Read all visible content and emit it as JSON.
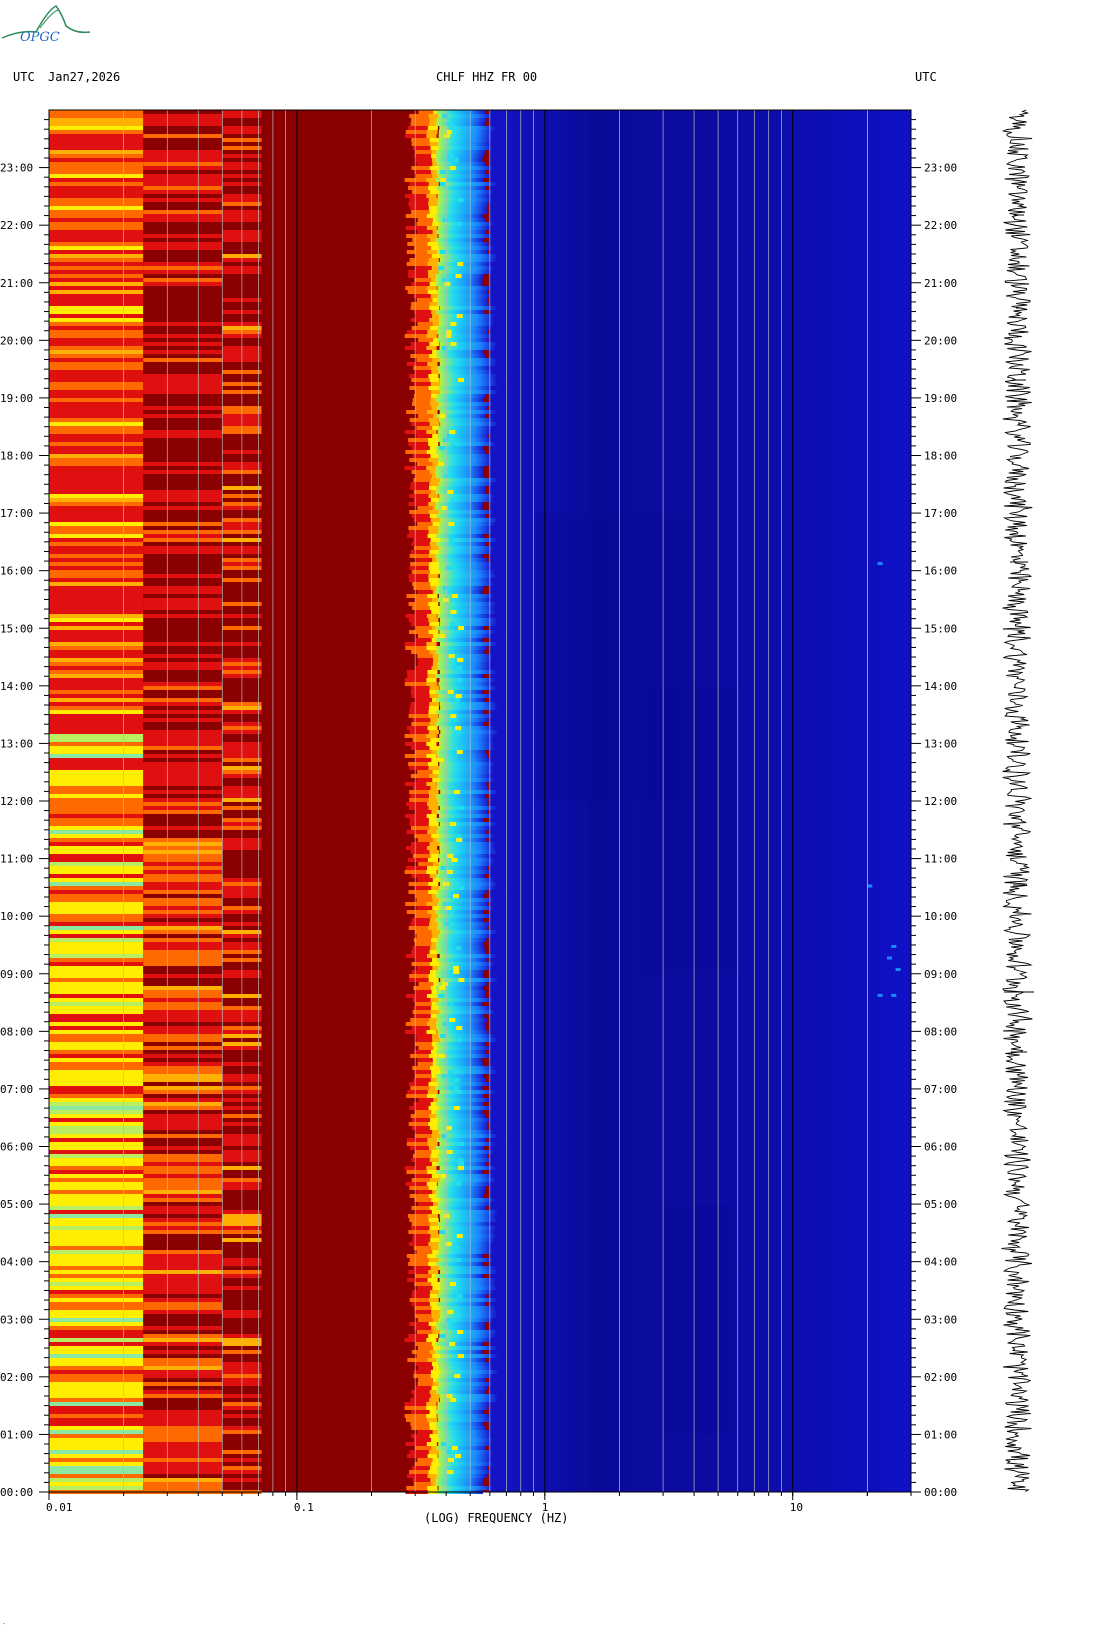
{
  "header": {
    "left_tz": "UTC",
    "date": "Jan27,2026",
    "station": "CHLF HHZ FR 00",
    "right_tz": "UTC"
  },
  "logo": {
    "text": "OPGC",
    "color": "#2e8b57"
  },
  "colors": {
    "dark_red": "#8b0000",
    "red": "#e01010",
    "orange": "#ff6a00",
    "yellow": "#ffee00",
    "cyan": "#22ddee",
    "light_blue": "#1a8cff",
    "blue": "#1010c8",
    "navy": "#0a0a96"
  },
  "chart_data": {
    "type": "heatmap",
    "xlabel": "(LOG) FREQUENCY (HZ)",
    "xscale": "log",
    "xlim": [
      0.01,
      30
    ],
    "x_ticks": [
      {
        "value": 0.01,
        "label": "0.01"
      },
      {
        "value": 0.1,
        "label": "0.1"
      },
      {
        "value": 1,
        "label": "1"
      },
      {
        "value": 10,
        "label": "10"
      }
    ],
    "ylim_hours": [
      0,
      24
    ],
    "y_ticks": [
      {
        "hour": 0,
        "label": "00:00"
      },
      {
        "hour": 1,
        "label": "01:00"
      },
      {
        "hour": 2,
        "label": "02:00"
      },
      {
        "hour": 3,
        "label": "03:00"
      },
      {
        "hour": 4,
        "label": "04:00"
      },
      {
        "hour": 5,
        "label": "05:00"
      },
      {
        "hour": 6,
        "label": "06:00"
      },
      {
        "hour": 7,
        "label": "07:00"
      },
      {
        "hour": 8,
        "label": "08:00"
      },
      {
        "hour": 9,
        "label": "09:00"
      },
      {
        "hour": 10,
        "label": "10:00"
      },
      {
        "hour": 11,
        "label": "11:00"
      },
      {
        "hour": 12,
        "label": "12:00"
      },
      {
        "hour": 13,
        "label": "13:00"
      },
      {
        "hour": 14,
        "label": "14:00"
      },
      {
        "hour": 15,
        "label": "15:00"
      },
      {
        "hour": 16,
        "label": "16:00"
      },
      {
        "hour": 17,
        "label": "17:00"
      },
      {
        "hour": 18,
        "label": "18:00"
      },
      {
        "hour": 19,
        "label": "19:00"
      },
      {
        "hour": 20,
        "label": "20:00"
      },
      {
        "hour": 21,
        "label": "21:00"
      },
      {
        "hour": 22,
        "label": "22:00"
      },
      {
        "hour": 23,
        "label": "23:00"
      }
    ],
    "frequency_bands": [
      {
        "f_min": 0.01,
        "f_max": 0.024,
        "color": "yellow-red banded"
      },
      {
        "f_min": 0.024,
        "f_max": 0.05,
        "color": "red-dark red banded"
      },
      {
        "f_min": 0.05,
        "f_max": 0.072,
        "color": "red-orange banded"
      },
      {
        "f_min": 0.072,
        "f_max": 0.29,
        "color": "dark red"
      },
      {
        "f_min": 0.29,
        "f_max": 0.37,
        "color": "red-orange-yellow"
      },
      {
        "f_min": 0.37,
        "f_max": 0.45,
        "color": "yellow-cyan"
      },
      {
        "f_min": 0.45,
        "f_max": 0.6,
        "color": "cyan-light blue"
      },
      {
        "f_min": 0.6,
        "f_max": 30,
        "color": "blue"
      }
    ],
    "grid": "vertical lines at each frequency decade subdivision"
  }
}
